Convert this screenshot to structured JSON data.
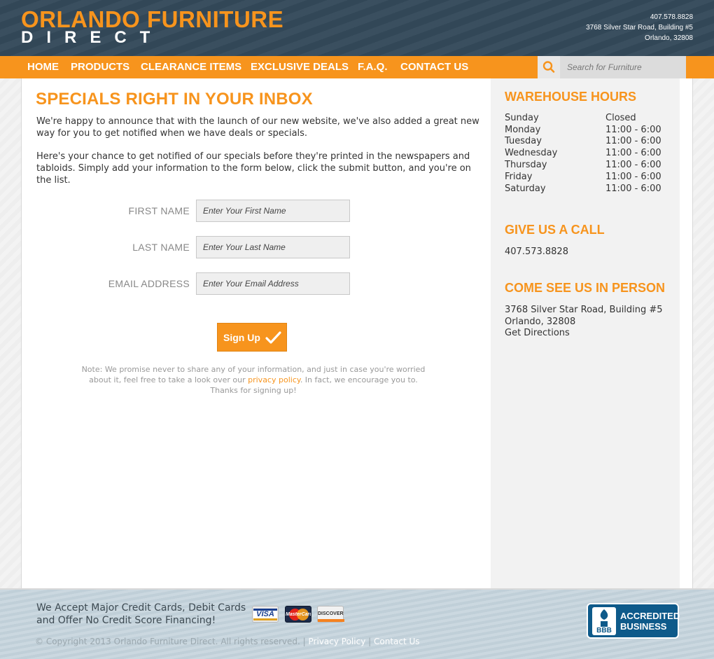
{
  "header": {
    "logo_top": "ORLANDO FURNITURE",
    "logo_bottom": "DIRECT",
    "phone": "407.578.8828",
    "address_line1": "3768 Silver Star Road, Building #5",
    "address_line2": "Orlando, 32808"
  },
  "nav": {
    "items": [
      "HOME",
      "PRODUCTS",
      "CLEARANCE ITEMS",
      "EXCLUSIVE DEALS",
      "F.A.Q.",
      "CONTACT US"
    ],
    "search_placeholder": "Search for Furniture",
    "colors": {
      "nav_bg": "#f7941d",
      "header_bg": "#34495a"
    }
  },
  "main": {
    "title": "SPECIALS RIGHT IN YOUR INBOX",
    "para1": "We're happy to announce that with the launch of our new website, we've also added a great new way for you to get notified when we have deals or specials.",
    "para2": "Here's your chance to get notified of our specials before they're printed in the newspapers and tabloids. Simply add your information to the form below, click the submit button, and you're on the list.",
    "form": {
      "first_name_label": "FIRST NAME",
      "first_name_placeholder": "Enter Your First Name",
      "last_name_label": "LAST NAME",
      "last_name_placeholder": "Enter Your Last Name",
      "email_label": "EMAIL ADDRESS",
      "email_placeholder": "Enter Your Email Address",
      "submit_label": "Sign Up"
    },
    "note_before": "Note: We promise never to share any of your information, and just in case you're worried about it, feel free to take a look over our ",
    "note_link": "privacy policy",
    "note_after": ". In fact, we encourage you to.",
    "note_thanks": "Thanks for signing up!"
  },
  "sidebar": {
    "hours_title": "WAREHOUSE HOURS",
    "hours": [
      {
        "day": "Sunday",
        "time": "Closed"
      },
      {
        "day": "Monday",
        "time": "11:00 - 6:00"
      },
      {
        "day": "Tuesday",
        "time": "11:00 - 6:00"
      },
      {
        "day": "Wednesday",
        "time": "11:00 - 6:00"
      },
      {
        "day": "Thursday",
        "time": "11:00 - 6:00"
      },
      {
        "day": "Friday",
        "time": "11:00 - 6:00"
      },
      {
        "day": "Saturday",
        "time": "11:00 - 6:00"
      }
    ],
    "call_title": "GIVE US A CALL",
    "call_phone": "407.573.8828",
    "visit_title": "COME SEE US IN PERSON",
    "visit_line1": "3768 Silver Star Road, Building #5",
    "visit_line2": "Orlando, 32808",
    "directions_label": "Get Directions"
  },
  "footer": {
    "accept_line1": "We Accept Major Credit Cards, Debit Cards",
    "accept_line2": "and Offer No Credit Score Financing!",
    "cards": [
      "VISA",
      "MasterCard",
      "DISCOVER"
    ],
    "copyright": "© Copyright 2013 Orlando Furniture Direct. All rights reserved.",
    "separator": "|",
    "privacy_label": "Privacy Policy",
    "contact_label": "Contact Us",
    "bbb_line1": "ACCREDITED",
    "bbb_line2": "BUSINESS",
    "bbb_logo": "BBB"
  }
}
